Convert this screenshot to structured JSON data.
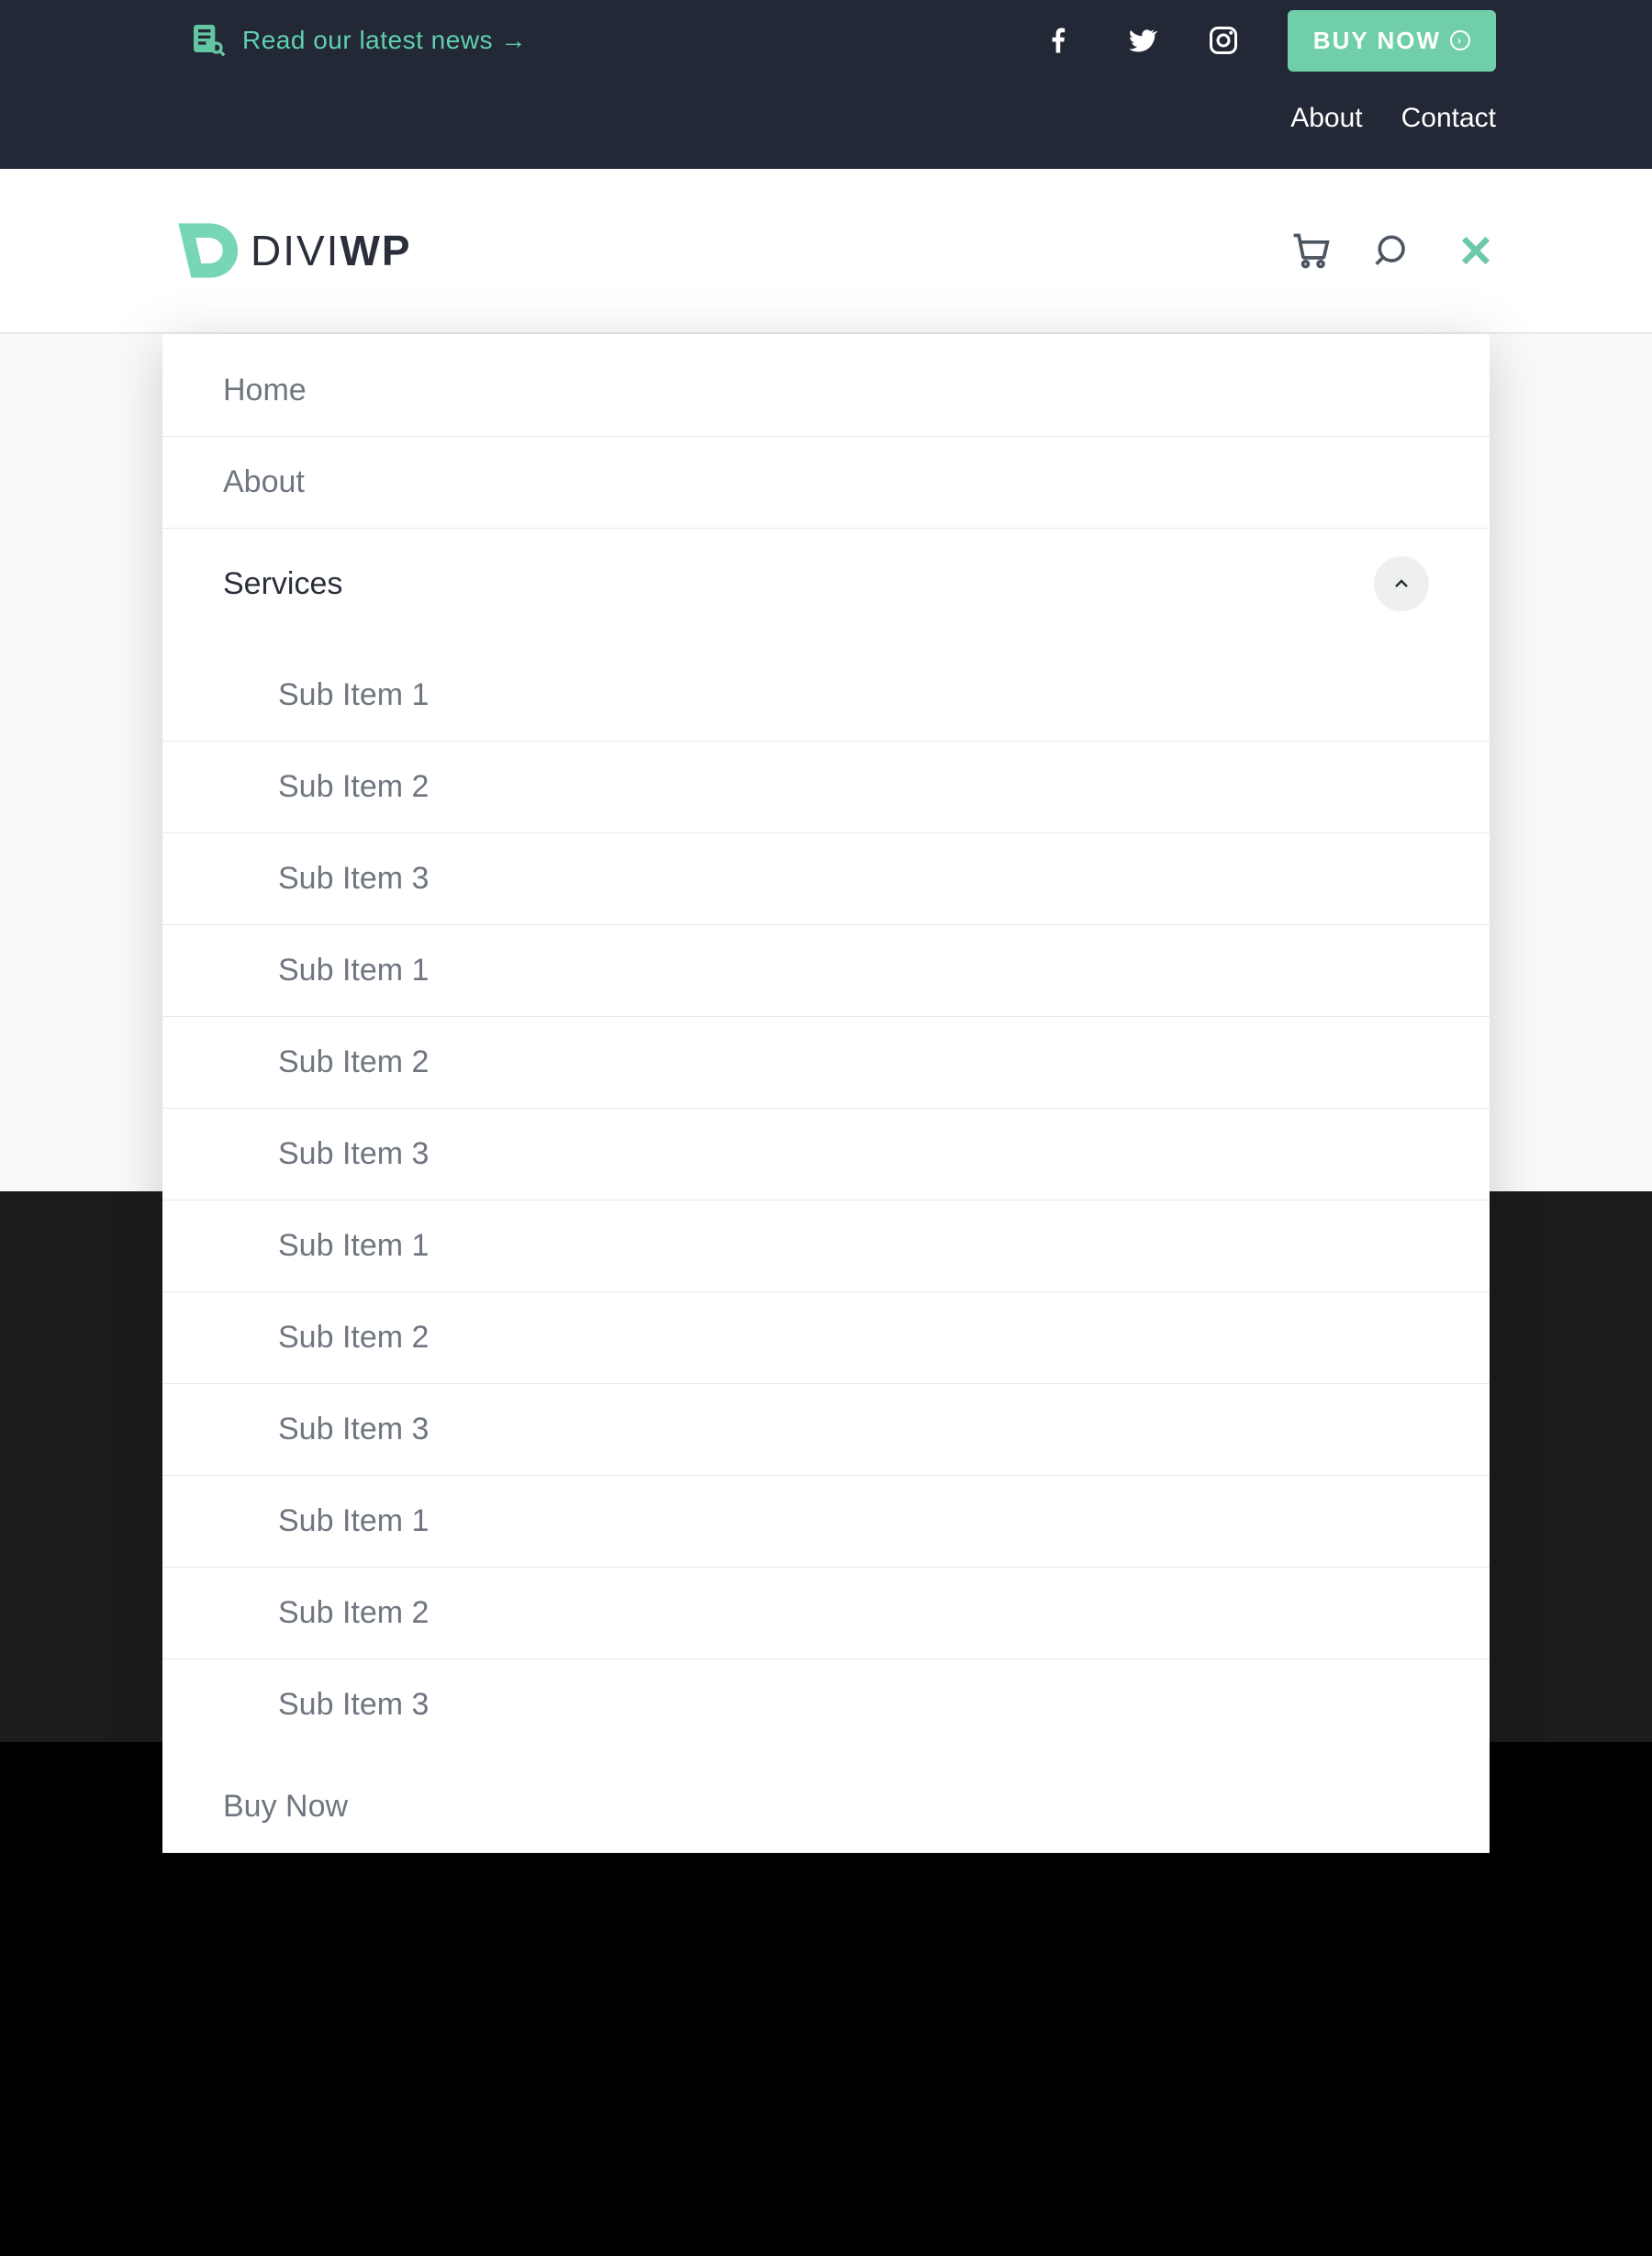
{
  "topbar": {
    "news_text": "Read our latest news →",
    "buy_btn": "BUY NOW",
    "nav": {
      "about": "About",
      "contact": "Contact"
    }
  },
  "brand": {
    "name_light": "DIVI",
    "name_bold": "WP"
  },
  "menu": {
    "home": "Home",
    "about": "About",
    "services": "Services",
    "buy_now": "Buy Now",
    "sub": [
      "Sub Item 1",
      "Sub Item 2",
      "Sub Item 3",
      "Sub Item 1",
      "Sub Item 2",
      "Sub Item 3",
      "Sub Item 1",
      "Sub Item 2",
      "Sub Item 3",
      "Sub Item 1",
      "Sub Item 2",
      "Sub Item 3"
    ]
  }
}
